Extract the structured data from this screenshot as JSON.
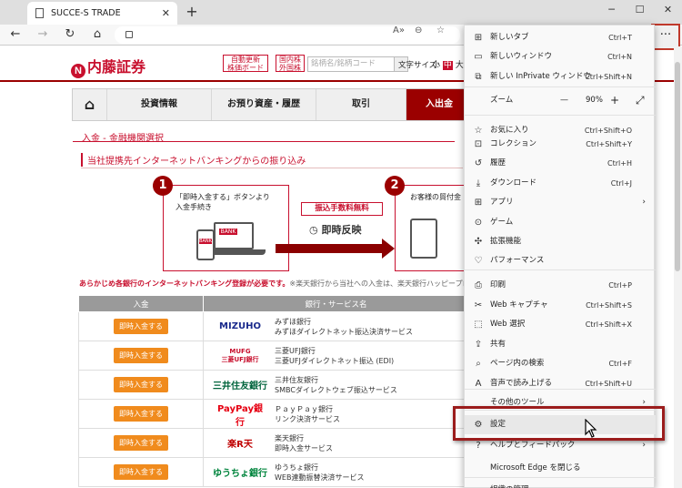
{
  "browser": {
    "tab_title": "SUCCE-S TRADE",
    "new_tab": "+",
    "window_controls": [
      "─",
      "☐",
      "✕"
    ],
    "more_label": "···",
    "reader_label": "A»",
    "icons": [
      "back-icon",
      "forward-icon",
      "refresh-icon",
      "home-icon",
      "lock-icon",
      "read-aloud-icon",
      "zoom-icon",
      "favorites-star-icon",
      "more-icon"
    ]
  },
  "site": {
    "logo": "内藤証券",
    "logo_mark": "N",
    "auto_update": "自動更新\n株価ボード",
    "foreign": "国内株\n外国株",
    "search_placeholder": "銘柄名/銘柄コード",
    "font_size_label": "文字サイズ:",
    "font_sizes": [
      "小",
      "中",
      "大"
    ],
    "nav": [
      "投資情報",
      "お預り資産・履歴",
      "取引",
      "入出金"
    ],
    "page_subtitle": "入金 - 金融機関選択",
    "section_title": "当社提携先インターネットバンキングからの振り込み",
    "step1_num": "1",
    "step1_text": "「即時入金する」ボタンより\n入金手続き",
    "step2_num": "2",
    "step2_text": "お客様の貿付金",
    "fee_text": "振込手数料無料",
    "instant_text": "即時反映",
    "bank_screen": "BANK",
    "bank_phone": "BANK",
    "notice_bold": "あらかじめ各銀行のインターネットバンキング登録が必要です。",
    "notice_rest": "※楽天銀行から当社への入金は、楽天銀行ハッピープログラムの対象外",
    "table_headers": [
      "入金",
      "銀行・サービス名"
    ],
    "deposit_button": "即時入金する",
    "banks": [
      {
        "logo": "MIZUHO",
        "logo_color": "#1a2a8c",
        "name": "みずほ銀行",
        "service": "みずほダイレクトネット振込決済サービス"
      },
      {
        "logo": "MUFG\n三菱UFJ銀行",
        "logo_color": "#c8102e",
        "name": "三菱UFJ銀行",
        "service": "三菱UFJダイレクトネット振込 (EDI)"
      },
      {
        "logo": "三井住友銀行",
        "logo_color": "#00643c",
        "name": "三井住友銀行",
        "service": "SMBCダイレクトウェブ振込サービス"
      },
      {
        "logo": "PayPay銀行",
        "logo_color": "#e60012",
        "name": "ＰａｙＰａｙ銀行",
        "service": "リンク決済サービス"
      },
      {
        "logo": "楽R天",
        "logo_color": "#bf0000",
        "name": "楽天銀行",
        "service": "即時入金サービス"
      },
      {
        "logo": "ゆうちょ銀行",
        "logo_color": "#00843d",
        "name": "ゆうちょ銀行",
        "service": "WEB連動振替決済サービス"
      }
    ]
  },
  "menu": {
    "items": [
      {
        "icon": "new-tab-icon",
        "glyph": "⊞",
        "label": "新しいタブ",
        "shortcut": "Ctrl+T"
      },
      {
        "icon": "new-window-icon",
        "glyph": "▭",
        "label": "新しいウィンドウ",
        "shortcut": "Ctrl+N"
      },
      {
        "icon": "inprivate-icon",
        "glyph": "⧉",
        "label": "新しい InPrivate ウィンドウ",
        "shortcut": "Ctrl+Shift+N"
      },
      {
        "icon": "favorites-icon",
        "glyph": "☆",
        "label": "お気に入り",
        "shortcut": "Ctrl+Shift+O"
      },
      {
        "icon": "collections-icon",
        "glyph": "⊡",
        "label": "コレクション",
        "shortcut": "Ctrl+Shift+Y"
      },
      {
        "icon": "history-icon",
        "glyph": "↺",
        "label": "履歴",
        "shortcut": "Ctrl+H"
      },
      {
        "icon": "download-icon",
        "glyph": "⤓",
        "label": "ダウンロード",
        "shortcut": "Ctrl+J"
      },
      {
        "icon": "apps-icon",
        "glyph": "⊞",
        "label": "アプリ",
        "shortcut": "",
        "arrow": "›"
      },
      {
        "icon": "games-icon",
        "glyph": "⊙",
        "label": "ゲーム",
        "shortcut": ""
      },
      {
        "icon": "extensions-icon",
        "glyph": "✣",
        "label": "拡張機能",
        "shortcut": ""
      },
      {
        "icon": "performance-icon",
        "glyph": "♡",
        "label": "パフォーマンス",
        "shortcut": ""
      },
      {
        "icon": "print-icon",
        "glyph": "⎙",
        "label": "印刷",
        "shortcut": "Ctrl+P"
      },
      {
        "icon": "web-capture-icon",
        "glyph": "✂",
        "label": "Web キャプチャ",
        "shortcut": "Ctrl+Shift+S"
      },
      {
        "icon": "web-select-icon",
        "glyph": "⬚",
        "label": "Web 選択",
        "shortcut": "Ctrl+Shift+X"
      },
      {
        "icon": "share-icon",
        "glyph": "⇪",
        "label": "共有",
        "shortcut": ""
      },
      {
        "icon": "find-on-page-icon",
        "glyph": "⌕",
        "label": "ページ内の検索",
        "shortcut": "Ctrl+F"
      },
      {
        "icon": "read-aloud-icon",
        "glyph": "A",
        "label": "音声で読み上げる",
        "shortcut": "Ctrl+Shift+U"
      },
      {
        "icon": "more-tools-icon",
        "glyph": "",
        "label": "その他のツール",
        "shortcut": "",
        "arrow": "›"
      },
      {
        "icon": "settings-icon",
        "glyph": "⚙",
        "label": "設定",
        "shortcut": ""
      },
      {
        "icon": "help-icon",
        "glyph": "?",
        "label": "ヘルプとフィードバック",
        "shortcut": "",
        "arrow": "›"
      },
      {
        "icon": "close-edge-icon",
        "glyph": "",
        "label": "Microsoft Edge を閉じる",
        "shortcut": ""
      }
    ],
    "zoom_label": "ズーム",
    "zoom_minus": "—",
    "zoom_value": "90%",
    "zoom_plus": "+",
    "zoom_full": "⤢",
    "bottom_cut": "組織の管理"
  }
}
